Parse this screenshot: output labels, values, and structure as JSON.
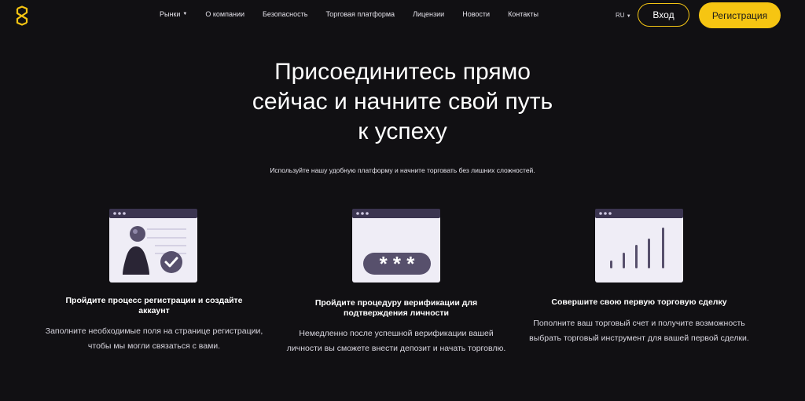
{
  "header": {
    "nav": [
      {
        "label": "Рынки",
        "has_caret": true
      },
      {
        "label": "О компании"
      },
      {
        "label": "Безопасность"
      },
      {
        "label": "Торговая платформа"
      },
      {
        "label": "Лицензии"
      },
      {
        "label": "Новости"
      },
      {
        "label": "Контакты"
      }
    ],
    "lang": "RU",
    "login_label": "Вход",
    "register_label": "Регистрация"
  },
  "hero": {
    "title_lines": [
      "Присоединитесь прямо",
      "сейчас и начните свой путь",
      "к успеху"
    ],
    "subtitle": "Используйте нашу удобную платформу и начните торговать без лишних сложностей."
  },
  "steps": [
    {
      "title": "Пройдите процесс регистрации и создайте аккаунт",
      "description": "Заполните необходимые поля на странице регистрации, чтобы мы могли связаться с вами.",
      "icon": "registration-window-icon"
    },
    {
      "title": "Пройдите процедуру верификации для подтверждения личности",
      "description": "Немедленно после успешной верификации вашей личности вы сможете внести депозит и начать торговлю.",
      "icon": "password-window-icon"
    },
    {
      "title": "Совершите свою первую торговую сделку",
      "description": "Пополните ваш торговый счет и получите возможность выбрать торговый инструмент для вашей первой сделки.",
      "icon": "bar-chart-window-icon"
    }
  ],
  "colors": {
    "accent": "#f6c512",
    "background": "#111013",
    "illustration_dark": "#3b3550"
  }
}
